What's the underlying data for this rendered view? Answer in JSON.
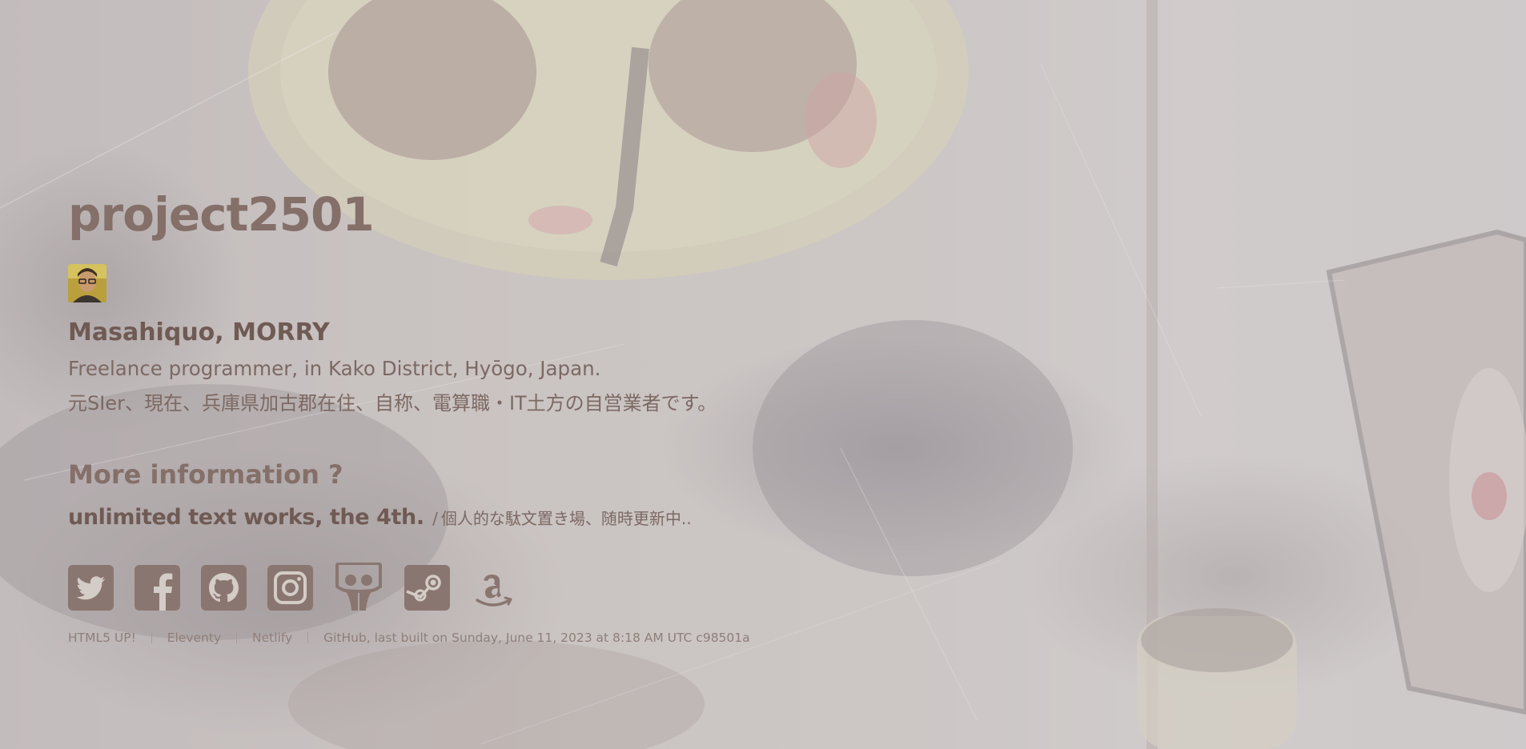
{
  "site": {
    "title": "project2501"
  },
  "author": {
    "name": "Masahiquo, MORRY",
    "tagline": "Freelance programmer, in Kako District, Hyōgo, Japan.",
    "tagline_ja": "元SIer、現在、兵庫県加古郡在住、自称、電算職・IT土方の自営業者です。"
  },
  "more": {
    "heading": "More information ?",
    "link_label": "unlimited text works, the 4th.",
    "separator": "/",
    "link_description": "個人的な駄文置き場、随時更新中.."
  },
  "social": [
    {
      "name": "Twitter",
      "icon": "twitter-icon"
    },
    {
      "name": "Facebook",
      "icon": "facebook-icon"
    },
    {
      "name": "GitHub",
      "icon": "github-icon"
    },
    {
      "name": "Instagram",
      "icon": "instagram-icon"
    },
    {
      "name": "SlideShare",
      "icon": "slideshare-icon"
    },
    {
      "name": "Steam",
      "icon": "steam-icon"
    },
    {
      "name": "Amazon",
      "icon": "amazon-icon"
    }
  ],
  "footer": {
    "credit_1": "HTML5 UP!",
    "credit_2": "Eleventy",
    "credit_3": "Netlify",
    "build_info": "GitHub, last built on Sunday, June 11, 2023 at 8:18 AM UTC c98501a"
  },
  "colors": {
    "text": "#7c6963",
    "text_strong": "#6f5a54",
    "title": "#846f69",
    "icon": "#8a7670"
  }
}
